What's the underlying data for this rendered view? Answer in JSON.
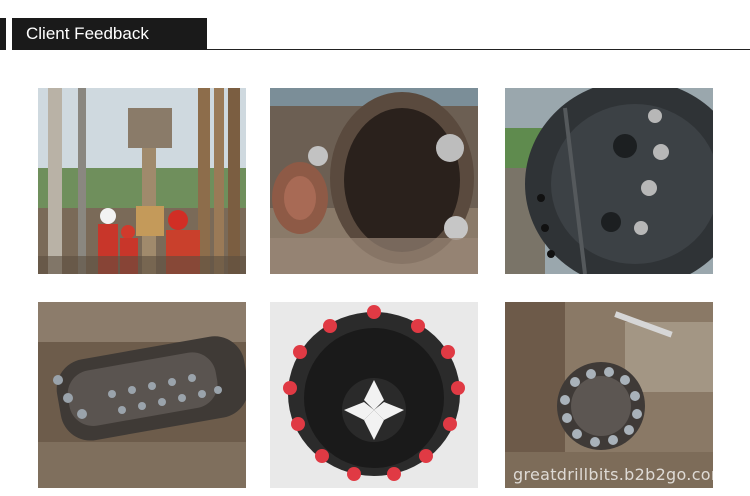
{
  "header": {
    "title": "Client Feedback"
  },
  "gallery": {
    "watermark": "greatdrillbits.b2b2go.com"
  }
}
